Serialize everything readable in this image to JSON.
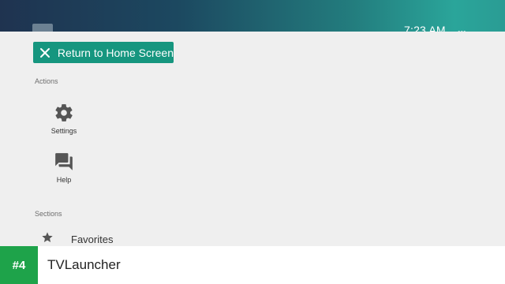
{
  "statusbar": {
    "time": "7:23 AM",
    "more": "•••"
  },
  "menu": {
    "return_label": "Return to Home Screen",
    "actions_heading": "Actions",
    "actions": [
      {
        "label": "Settings",
        "icon": "gear-icon"
      },
      {
        "label": "Help",
        "icon": "chat-question-icon"
      }
    ],
    "sections_heading": "Sections",
    "sections": [
      {
        "label": "Favorites",
        "icon": "star-icon"
      }
    ]
  },
  "banner": {
    "rank": "#4",
    "app_name": "TVLauncher"
  },
  "colors": {
    "accent": "#16967f",
    "badge": "#1ea34a"
  }
}
